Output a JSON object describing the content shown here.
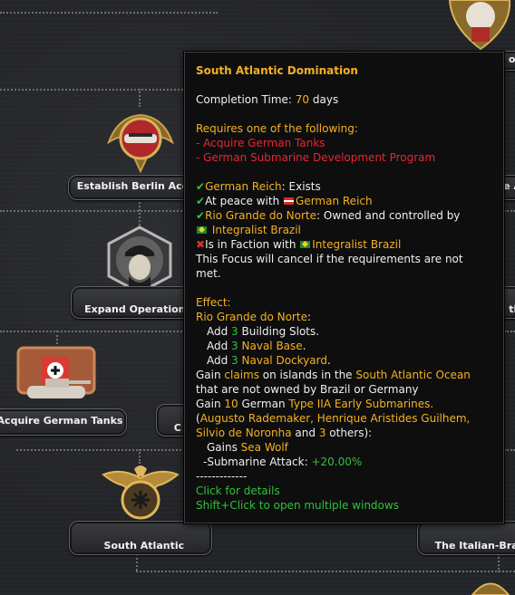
{
  "focus_tree": {
    "nodes": [
      {
        "id": "establish_berlin",
        "label": "Establish Berlin Acc"
      },
      {
        "id": "expand_operation",
        "label": "Expand Operation\nBolívar"
      },
      {
        "id": "acquire_german_tanks",
        "label": "Acquire German Tanks"
      },
      {
        "id": "south_atlantic",
        "label": "South Atlantic\nDomination"
      },
      {
        "id": "italian_brazil",
        "label": "The Italian-Braz\nPartition of Af"
      },
      {
        "id": "partial_c",
        "label": "C\nDe"
      },
      {
        "id": "partial_right_a",
        "label": "e A"
      },
      {
        "id": "partial_right_th",
        "label": "th\ntr"
      },
      {
        "id": "partial_of",
        "label": "of"
      }
    ]
  },
  "tooltip": {
    "title": "South Atlantic Domination",
    "completion_label": "Completion Time: ",
    "completion_value": "70",
    "completion_unit": " days",
    "requires_header": "Requires one of the following:",
    "requires": [
      "- Acquire German Tanks",
      "- German Submarine Development Program"
    ],
    "conditions": {
      "c1_country": "German Reich",
      "c1_text": ": Exists",
      "c2_text": "At peace with ",
      "c2_country": "German Reich",
      "c3_state": "Rio Grande do Norte",
      "c3_text": ": Owned and controlled by",
      "c3_country": "Integralist Brazil",
      "c4_text": "Is in Faction with ",
      "c4_country": "Integralist Brazil",
      "cancel_text_1": "This Focus will cancel if the requirements are not",
      "cancel_text_2": "met."
    },
    "effect": {
      "header": "Effect:",
      "state": "Rio Grande do Norte",
      "state_suffix": ":",
      "add1_pre": "Add ",
      "add1_num": "3",
      "add1_post": " Building Slots.",
      "add2_pre": "Add ",
      "add2_num": "3",
      "add2_post": "Naval Base",
      "add3_pre": "Add ",
      "add3_num": "3",
      "add3_post": "Naval Dockyard",
      "claims_pre": "Gain ",
      "claims_word": "claims",
      "claims_mid": " on islands in the ",
      "claims_region": "South Atlantic Ocean",
      "claims_line2": "that are not owned by Brazil or Germany",
      "gain_pre": "Gain ",
      "gain_num": "10",
      "gain_mid": " German ",
      "gain_unit": "Type IIA Early Submarines.",
      "names_open": "(",
      "names_list": "Augusto Rademaker, Henrique Aristides Guilhem,",
      "names_list2": "Silvio de Noronha",
      "names_and": " and ",
      "names_num": "3",
      "names_close": " others):",
      "trait_pre": "Gains ",
      "trait": "Sea Wolf",
      "attack_label": "-Submarine Attack: ",
      "attack_value": "+20.00%",
      "divider": "-------------",
      "hint1": "Click for details",
      "hint2": "Shift+Click to open multiple windows"
    }
  },
  "colors": {
    "highlight": "#f5b120",
    "negative": "#e8262f",
    "positive": "#2fc23a"
  }
}
